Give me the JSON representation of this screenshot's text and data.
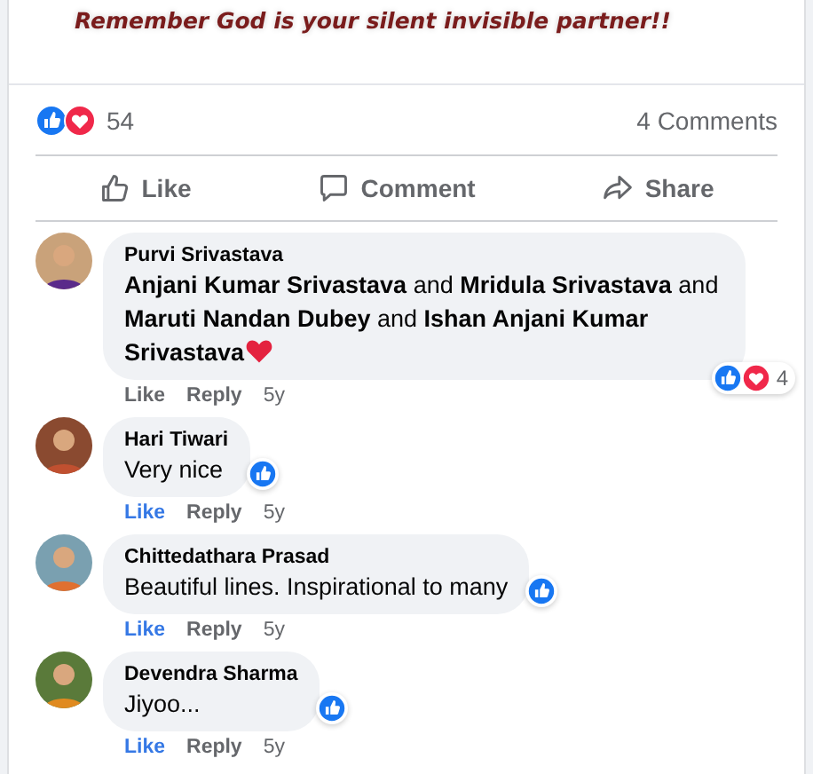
{
  "post": {
    "image_text": "Remember God is your silent invisible partner!!"
  },
  "summary": {
    "reactions": [
      {
        "kind": "like"
      },
      {
        "kind": "love"
      }
    ],
    "count": "54",
    "comments": "4 Comments"
  },
  "actions": [
    {
      "kind": "like",
      "label": "Like"
    },
    {
      "kind": "comment",
      "label": "Comment"
    },
    {
      "kind": "share",
      "label": "Share"
    }
  ],
  "comments": [
    {
      "author": "Purvi Srivastava",
      "text": "**Anjani Kumar Srivastava** and **Mridula Srivastava** and **Maruti Nandan Dubey** and **Ishan Anjani Kumar Srivastava**",
      "heart_emoji": true,
      "reactions": [
        {
          "kind": "like"
        },
        {
          "kind": "love"
        }
      ],
      "reaction_count": "4",
      "liked": false,
      "like": "Like",
      "reply": "Reply",
      "time": "5y"
    },
    {
      "author": "Hari Tiwari",
      "text": "Very nice",
      "reactions": [
        {
          "kind": "like"
        }
      ],
      "liked": true,
      "like": "Like",
      "reply": "Reply",
      "time": "5y"
    },
    {
      "author": "Chittedathara Prasad",
      "text": "Beautiful lines. Inspirational to many",
      "reactions": [
        {
          "kind": "like"
        }
      ],
      "liked": true,
      "like": "Like",
      "reply": "Reply",
      "time": "5y"
    },
    {
      "author": "Devendra Sharma",
      "text": "Jiyoo...",
      "reactions": [
        {
          "kind": "like"
        }
      ],
      "liked": true,
      "like": "Like",
      "reply": "Reply",
      "time": "5y"
    }
  ]
}
